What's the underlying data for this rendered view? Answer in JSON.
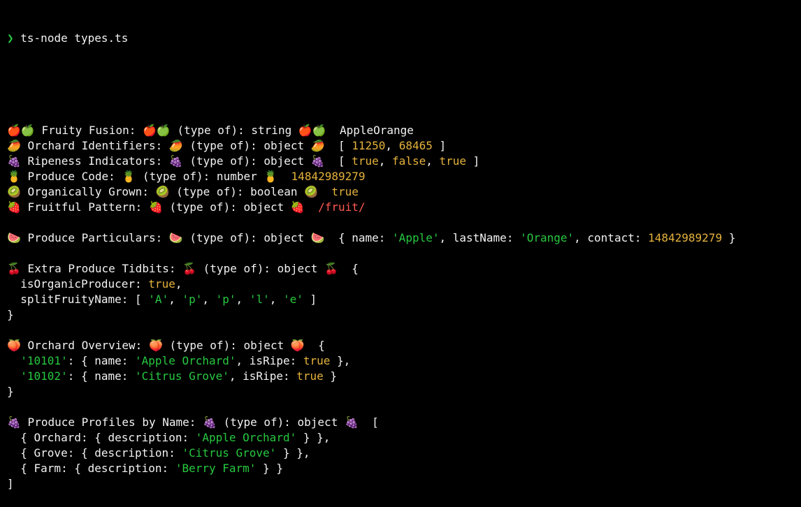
{
  "colors": {
    "background": "#000000",
    "text": "#f2f2f2",
    "prompt_arrow": "#28c840",
    "number_boolean": "#e5b23d",
    "string": "#28c840",
    "regex": "#ff5a52"
  },
  "prompt": {
    "symbol": "❯",
    "command": "ts-node types.ts"
  },
  "lines": [
    [
      {
        "t": "🍎🍏 Fruity Fusion: 🍎🍏 (type of): string 🍎🍏  AppleOrange",
        "c": "def"
      }
    ],
    [
      {
        "t": "🥭 Orchard Identifiers: 🥭 (type of): object 🥭  [ ",
        "c": "def"
      },
      {
        "t": "11250",
        "c": "n"
      },
      {
        "t": ", ",
        "c": "def"
      },
      {
        "t": "68465",
        "c": "n"
      },
      {
        "t": " ]",
        "c": "def"
      }
    ],
    [
      {
        "t": "🍇 Ripeness Indicators: 🍇 (type of): object 🍇  [ ",
        "c": "def"
      },
      {
        "t": "true",
        "c": "n"
      },
      {
        "t": ", ",
        "c": "def"
      },
      {
        "t": "false",
        "c": "n"
      },
      {
        "t": ", ",
        "c": "def"
      },
      {
        "t": "true",
        "c": "n"
      },
      {
        "t": " ]",
        "c": "def"
      }
    ],
    [
      {
        "t": "🍍 Produce Code: 🍍 (type of): number 🍍  ",
        "c": "def"
      },
      {
        "t": "14842989279",
        "c": "n"
      }
    ],
    [
      {
        "t": "🥝 Organically Grown: 🥝 (type of): boolean 🥝  ",
        "c": "def"
      },
      {
        "t": "true",
        "c": "n"
      }
    ],
    [
      {
        "t": "🍓 Fruitful Pattern: 🍓 (type of): object 🍓  ",
        "c": "def"
      },
      {
        "t": "/fruit/",
        "c": "r"
      }
    ],
    [],
    [
      {
        "t": "🍉 Produce Particulars: 🍉 (type of): object 🍉  { name: ",
        "c": "def"
      },
      {
        "t": "'Apple'",
        "c": "s"
      },
      {
        "t": ", lastName: ",
        "c": "def"
      },
      {
        "t": "'Orange'",
        "c": "s"
      },
      {
        "t": ", contact: ",
        "c": "def"
      },
      {
        "t": "14842989279",
        "c": "n"
      },
      {
        "t": " }",
        "c": "def"
      }
    ],
    [],
    [
      {
        "t": "🍒 Extra Produce Tidbits: 🍒 (type of): object 🍒  {",
        "c": "def"
      }
    ],
    [
      {
        "t": "  isOrganicProducer: ",
        "c": "def"
      },
      {
        "t": "true",
        "c": "n"
      },
      {
        "t": ",",
        "c": "def"
      }
    ],
    [
      {
        "t": "  splitFruityName: [ ",
        "c": "def"
      },
      {
        "t": "'A'",
        "c": "s"
      },
      {
        "t": ", ",
        "c": "def"
      },
      {
        "t": "'p'",
        "c": "s"
      },
      {
        "t": ", ",
        "c": "def"
      },
      {
        "t": "'p'",
        "c": "s"
      },
      {
        "t": ", ",
        "c": "def"
      },
      {
        "t": "'l'",
        "c": "s"
      },
      {
        "t": ", ",
        "c": "def"
      },
      {
        "t": "'e'",
        "c": "s"
      },
      {
        "t": " ]",
        "c": "def"
      }
    ],
    [
      {
        "t": "}",
        "c": "def"
      }
    ],
    [],
    [
      {
        "t": "🍑 Orchard Overview: 🍑 (type of): object 🍑  {",
        "c": "def"
      }
    ],
    [
      {
        "t": "  ",
        "c": "def"
      },
      {
        "t": "'10101'",
        "c": "s"
      },
      {
        "t": ": { name: ",
        "c": "def"
      },
      {
        "t": "'Apple Orchard'",
        "c": "s"
      },
      {
        "t": ", isRipe: ",
        "c": "def"
      },
      {
        "t": "true",
        "c": "n"
      },
      {
        "t": " },",
        "c": "def"
      }
    ],
    [
      {
        "t": "  ",
        "c": "def"
      },
      {
        "t": "'10102'",
        "c": "s"
      },
      {
        "t": ": { name: ",
        "c": "def"
      },
      {
        "t": "'Citrus Grove'",
        "c": "s"
      },
      {
        "t": ", isRipe: ",
        "c": "def"
      },
      {
        "t": "true",
        "c": "n"
      },
      {
        "t": " }",
        "c": "def"
      }
    ],
    [
      {
        "t": "}",
        "c": "def"
      }
    ],
    [],
    [
      {
        "t": "🍇 Produce Profiles by Name: 🍇 (type of): object 🍇  [",
        "c": "def"
      }
    ],
    [
      {
        "t": "  { Orchard: { description: ",
        "c": "def"
      },
      {
        "t": "'Apple Orchard'",
        "c": "s"
      },
      {
        "t": " } },",
        "c": "def"
      }
    ],
    [
      {
        "t": "  { Grove: { description: ",
        "c": "def"
      },
      {
        "t": "'Citrus Grove'",
        "c": "s"
      },
      {
        "t": " } },",
        "c": "def"
      }
    ],
    [
      {
        "t": "  { Farm: { description: ",
        "c": "def"
      },
      {
        "t": "'Berry Farm'",
        "c": "s"
      },
      {
        "t": " } }",
        "c": "def"
      }
    ],
    [
      {
        "t": "]",
        "c": "def"
      }
    ]
  ]
}
